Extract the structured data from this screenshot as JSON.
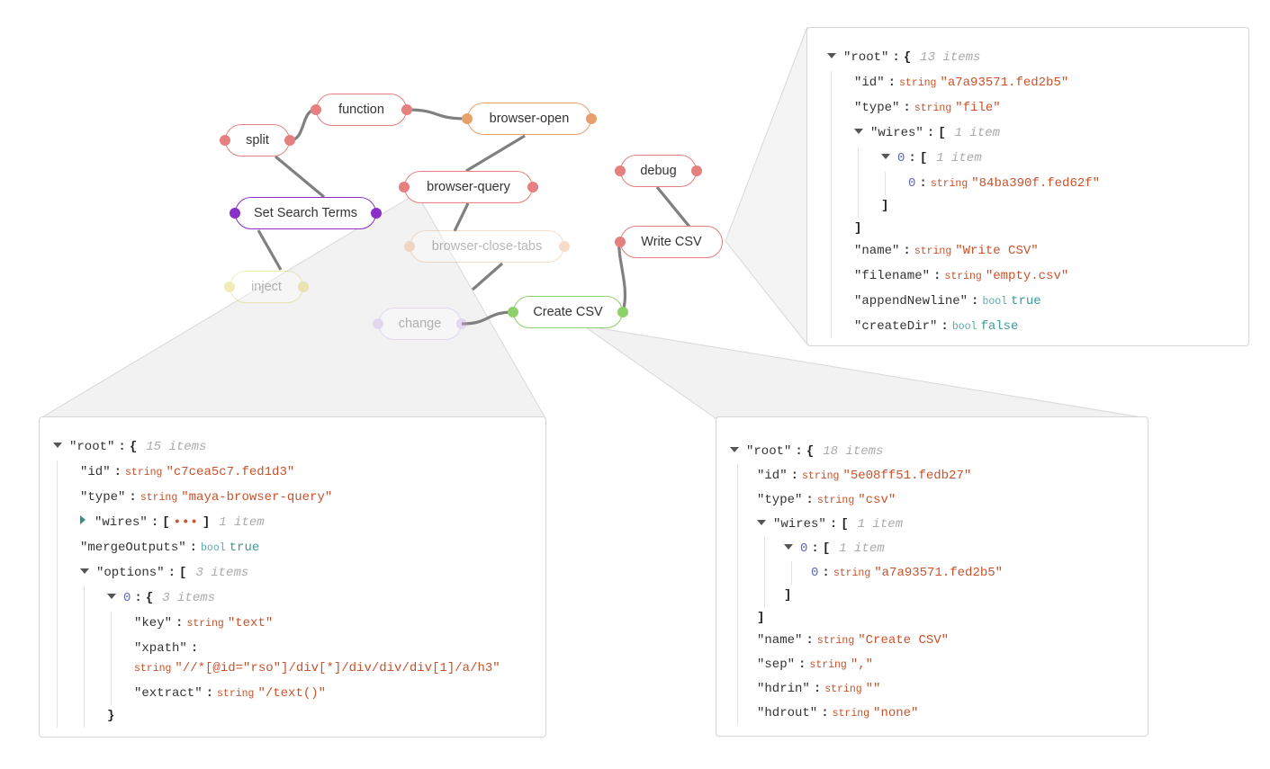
{
  "diagram": {
    "nodes": [
      {
        "id": "function",
        "label": "function",
        "color": "#e57f80",
        "in": true,
        "out": true,
        "faded": false
      },
      {
        "id": "browser-open",
        "label": "browser-open",
        "color": "#e8a06a",
        "in": true,
        "out": true,
        "faded": false
      },
      {
        "id": "split",
        "label": "split",
        "color": "#e57f80",
        "in": true,
        "out": true,
        "faded": false
      },
      {
        "id": "debug",
        "label": "debug",
        "color": "#e57f80",
        "in": true,
        "out": true,
        "faded": false
      },
      {
        "id": "browser-query",
        "label": "browser-query",
        "color": "#e57f80",
        "in": true,
        "out": true,
        "faded": false
      },
      {
        "id": "set-search-terms",
        "label": "Set Search Terms",
        "color": "#8b2fc9",
        "in": true,
        "out": true,
        "faded": false
      },
      {
        "id": "write-csv",
        "label": "Write CSV",
        "color": "#e57f80",
        "in": true,
        "out": false,
        "faded": false
      },
      {
        "id": "browser-close-tabs",
        "label": "browser-close-tabs",
        "color": "#e8a06a",
        "in": true,
        "out": true,
        "faded": true
      },
      {
        "id": "inject",
        "label": "inject",
        "color": "#d7c93a",
        "in": true,
        "out": true,
        "faded": true
      },
      {
        "id": "change",
        "label": "change",
        "color": "#c8a8ea",
        "in": true,
        "out": true,
        "faded": true
      },
      {
        "id": "create-csv",
        "label": "Create CSV",
        "color": "#8fd06a",
        "in": true,
        "out": true,
        "faded": false
      }
    ]
  },
  "panels": {
    "write_csv": {
      "rows": [
        {
          "d": 0,
          "caret": "down",
          "key": "root",
          "open": "{",
          "meta": "13 items"
        },
        {
          "d": 1,
          "key": "id",
          "type": "string",
          "value": "\"a7a93571.fed2b5\""
        },
        {
          "d": 1,
          "key": "type",
          "type": "string",
          "value": "\"file\""
        },
        {
          "d": 1,
          "caret": "down",
          "key": "wires",
          "open": "[",
          "meta": "1 item"
        },
        {
          "d": 2,
          "caret": "down",
          "index": "0",
          "open": "[",
          "meta": "1 item"
        },
        {
          "d": 3,
          "index": "0",
          "type": "string",
          "value": "\"84ba390f.fed62f\""
        },
        {
          "d": 2,
          "close": "]"
        },
        {
          "d": 1,
          "close": "]"
        },
        {
          "d": 1,
          "key": "name",
          "type": "string",
          "value": "\"Write CSV\""
        },
        {
          "d": 1,
          "key": "filename",
          "type": "string",
          "value": "\"empty.csv\""
        },
        {
          "d": 1,
          "key": "appendNewline",
          "type": "bool",
          "value": "true"
        },
        {
          "d": 1,
          "key": "createDir",
          "type": "bool",
          "value": "false"
        }
      ]
    },
    "browser_query": {
      "rows": [
        {
          "d": 0,
          "caret": "down",
          "key": "root",
          "open": "{",
          "meta": "15 items"
        },
        {
          "d": 1,
          "key": "id",
          "type": "string",
          "value": "\"c7cea5c7.fed1d3\""
        },
        {
          "d": 1,
          "key": "type",
          "type": "string",
          "value": "\"maya-browser-query\""
        },
        {
          "d": 1,
          "caret": "right",
          "key": "wires",
          "open": "[",
          "ellipsis": "•••",
          "close_inline": "]",
          "meta": "1 item"
        },
        {
          "d": 1,
          "key": "mergeOutputs",
          "type": "bool",
          "value": "true"
        },
        {
          "d": 1,
          "caret": "down",
          "key": "options",
          "open": "[",
          "meta": "3 items"
        },
        {
          "d": 2,
          "caret": "down",
          "index": "0",
          "open": "{",
          "meta": "3 items"
        },
        {
          "d": 3,
          "key": "key",
          "type": "string",
          "value": "\"text\""
        },
        {
          "d": 3,
          "key": "xpath",
          "type": null,
          "value": null
        },
        {
          "d": 3,
          "cont": true,
          "type": "string",
          "value": "\"//*[@id=\"rso\"]/div[*]/div/div/div[1]/a/h3\""
        },
        {
          "d": 3,
          "key": "extract",
          "type": "string",
          "value": "\"/text()\""
        },
        {
          "d": 2,
          "close": "}"
        }
      ]
    },
    "create_csv": {
      "rows": [
        {
          "d": 0,
          "caret": "down",
          "key": "root",
          "open": "{",
          "meta": "18 items"
        },
        {
          "d": 1,
          "key": "id",
          "type": "string",
          "value": "\"5e08ff51.fedb27\""
        },
        {
          "d": 1,
          "key": "type",
          "type": "string",
          "value": "\"csv\""
        },
        {
          "d": 1,
          "caret": "down",
          "key": "wires",
          "open": "[",
          "meta": "1 item"
        },
        {
          "d": 2,
          "caret": "down",
          "index": "0",
          "open": "[",
          "meta": "1 item"
        },
        {
          "d": 3,
          "index": "0",
          "type": "string",
          "value": "\"a7a93571.fed2b5\""
        },
        {
          "d": 2,
          "close": "]"
        },
        {
          "d": 1,
          "close": "]"
        },
        {
          "d": 1,
          "key": "name",
          "type": "string",
          "value": "\"Create CSV\""
        },
        {
          "d": 1,
          "key": "sep",
          "type": "string",
          "value": "\",\""
        },
        {
          "d": 1,
          "key": "hdrin",
          "type": "string",
          "value": "\"\""
        },
        {
          "d": 1,
          "key": "hdrout",
          "type": "string",
          "value": "\"none\""
        }
      ]
    }
  }
}
